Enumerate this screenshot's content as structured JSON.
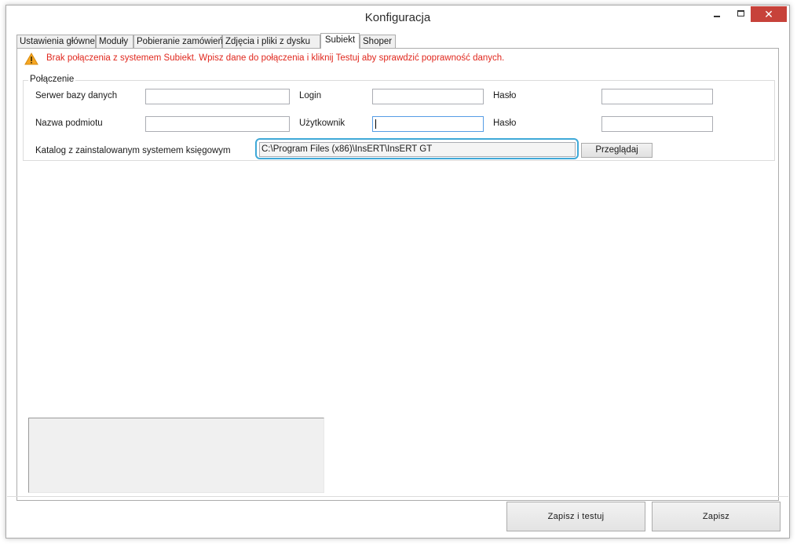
{
  "window": {
    "title": "Konfiguracja",
    "minimize_glyph": "_",
    "maximize_glyph": "□",
    "close_glyph": "✕"
  },
  "tabs": [
    {
      "label": "Ustawienia główne",
      "active": false
    },
    {
      "label": "Moduły",
      "active": false
    },
    {
      "label": "Pobieranie zamówień",
      "active": false
    },
    {
      "label": "Zdjęcia i pliki z dysku",
      "active": false
    },
    {
      "label": "Subiekt",
      "active": true
    },
    {
      "label": "Shoper",
      "active": false
    }
  ],
  "warning": {
    "icon": "warning-icon",
    "text": "Brak połączenia z systemem Subiekt. Wpisz dane do połączenia i kliknij Testuj aby sprawdzić poprawność danych.",
    "color": "#e0281e"
  },
  "connection": {
    "legend": "Połączenie",
    "server_label": "Serwer bazy danych",
    "server_value": "",
    "login_label": "Login",
    "login_value": "",
    "password1_label": "Hasło",
    "password1_value": "",
    "entity_label": "Nazwa podmiotu",
    "entity_value": "",
    "user_label": "Użytkownik",
    "user_value": "",
    "password2_label": "Hasło",
    "password2_value": "",
    "catalog_label": "Katalog z zainstalowanym systemem księgowym",
    "catalog_value": "C:\\Program Files (x86)\\InsERT\\InsERT GT",
    "browse_label": "Przeglądaj"
  },
  "footer": {
    "save_test_label": "Zapisz i testuj",
    "save_label": "Zapisz"
  },
  "colors": {
    "highlight": "#3fa9d8",
    "close_button": "#c7423a"
  }
}
